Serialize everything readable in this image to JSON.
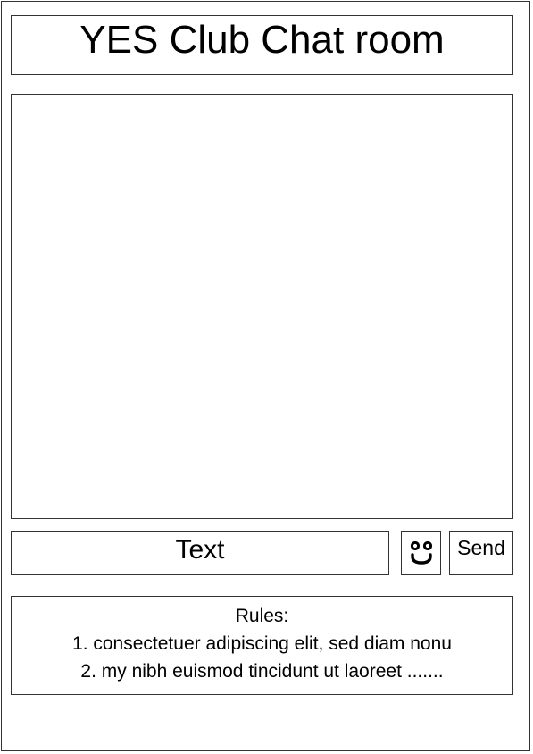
{
  "header": {
    "title": "YES Club Chat room"
  },
  "chat": {
    "messages": []
  },
  "composer": {
    "input_text": "Text",
    "emoji_icon": "smiley-face-icon",
    "send_label": "Send"
  },
  "rules": {
    "heading": "Rules:",
    "items": [
      "1. consectetuer adipiscing elit, sed diam nonu",
      "2. my nibh euismod tincidunt ut laoreet ......."
    ]
  }
}
